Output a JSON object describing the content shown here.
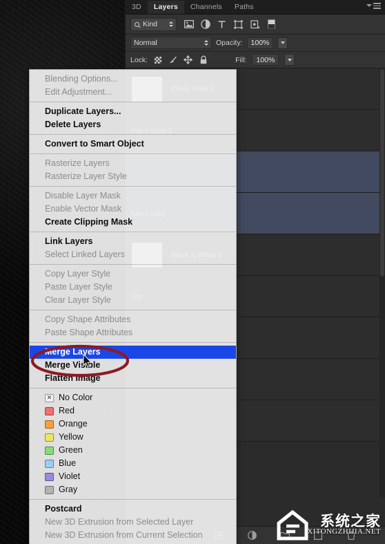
{
  "panel": {
    "tabs": [
      {
        "label": "3D",
        "active": false
      },
      {
        "label": "Layers",
        "active": true
      },
      {
        "label": "Channels",
        "active": false
      },
      {
        "label": "Paths",
        "active": false
      }
    ],
    "panel_menu_icon": "panel-menu-icon",
    "filter": {
      "search_icon": "search-icon",
      "kind_label": "Kind",
      "icons": [
        "image-filter-icon",
        "adjustment-filter-icon",
        "type-filter-icon",
        "shape-filter-icon",
        "smart-object-filter-icon",
        "mask-filter-icon"
      ]
    },
    "blend": {
      "mode": "Normal",
      "opacity_label": "Opacity:",
      "opacity_value": "100%"
    },
    "lock": {
      "label": "Lock:",
      "icons": [
        "lock-transparent-pixels-icon",
        "lock-image-pixels-icon",
        "lock-position-icon",
        "lock-all-icon"
      ],
      "fill_label": "Fill:",
      "fill_value": "100%"
    },
    "layers": [
      {
        "name": "Photo Filter 1",
        "selected": false,
        "thumb": true
      },
      {
        "name": "hite 1 copy 2",
        "selected": false,
        "thumb": false
      },
      {
        "name": "",
        "selected": true,
        "thumb": false
      },
      {
        "name": "hite 1 copy",
        "selected": true,
        "thumb": false
      },
      {
        "name": "Black & White 1",
        "selected": false,
        "thumb": true
      },
      {
        "name": "opy",
        "selected": false,
        "thumb": false
      },
      {
        "name": "",
        "selected": false,
        "thumb": false
      },
      {
        "name": "",
        "selected": false,
        "thumb": false
      },
      {
        "name": "",
        "selected": false,
        "thumb": false
      }
    ],
    "footer_icons": [
      "link-layers-icon",
      "layer-style-fx-icon",
      "add-layer-mask-icon",
      "new-adjustment-layer-icon",
      "new-group-icon",
      "new-layer-icon",
      "delete-layer-icon"
    ]
  },
  "context_menu": {
    "groups": [
      [
        {
          "label": "Blending Options...",
          "state": "disabled"
        },
        {
          "label": "Edit Adjustment...",
          "state": "disabled"
        }
      ],
      [
        {
          "label": "Duplicate Layers...",
          "state": "bold"
        },
        {
          "label": "Delete Layers",
          "state": "bold"
        }
      ],
      [
        {
          "label": "Convert to Smart Object",
          "state": "bold"
        }
      ],
      [
        {
          "label": "Rasterize Layers",
          "state": "disabled"
        },
        {
          "label": "Rasterize Layer Style",
          "state": "disabled"
        }
      ],
      [
        {
          "label": "Disable Layer Mask",
          "state": "disabled"
        },
        {
          "label": "Enable Vector Mask",
          "state": "disabled"
        },
        {
          "label": "Create Clipping Mask",
          "state": "bold"
        }
      ],
      [
        {
          "label": "Link Layers",
          "state": "bold"
        },
        {
          "label": "Select Linked Layers",
          "state": "disabled"
        }
      ],
      [
        {
          "label": "Copy Layer Style",
          "state": "disabled"
        },
        {
          "label": "Paste Layer Style",
          "state": "disabled"
        },
        {
          "label": "Clear Layer Style",
          "state": "disabled"
        }
      ],
      [
        {
          "label": "Copy Shape Attributes",
          "state": "disabled"
        },
        {
          "label": "Paste Shape Attributes",
          "state": "disabled"
        }
      ],
      [
        {
          "label": "Merge Layers",
          "state": "highlight"
        },
        {
          "label": "Merge Visible",
          "state": "bold"
        },
        {
          "label": "Flatten Image",
          "state": "bold"
        }
      ]
    ],
    "colors": [
      {
        "label": "No Color",
        "swatch": "none"
      },
      {
        "label": "Red",
        "swatch": "#f2706e"
      },
      {
        "label": "Orange",
        "swatch": "#f6a33c"
      },
      {
        "label": "Yellow",
        "swatch": "#eee564"
      },
      {
        "label": "Green",
        "swatch": "#8ada78"
      },
      {
        "label": "Blue",
        "swatch": "#9ccef5"
      },
      {
        "label": "Violet",
        "swatch": "#9b8be0"
      },
      {
        "label": "Gray",
        "swatch": "#b3b3b3"
      }
    ],
    "three_d": [
      {
        "label": "Postcard",
        "state": "bold"
      },
      {
        "label": "New 3D Extrusion from Selected Layer",
        "state": "disabled"
      },
      {
        "label": "New 3D Extrusion from Current Selection",
        "state": "disabled"
      }
    ],
    "highlight_color": "#1a47e8"
  },
  "annotation": {
    "ellipse_color": "#8e1a22",
    "target": "Merge Layers"
  },
  "watermark": {
    "chinese": "系统之家",
    "english": "XITONGZHIJIA.NET"
  }
}
